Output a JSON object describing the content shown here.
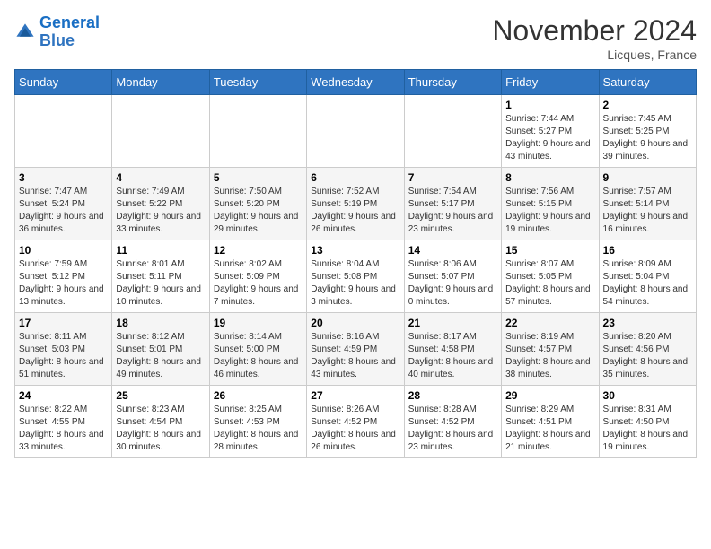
{
  "header": {
    "logo_line1": "General",
    "logo_line2": "Blue",
    "month_title": "November 2024",
    "subtitle": "Licques, France"
  },
  "weekdays": [
    "Sunday",
    "Monday",
    "Tuesday",
    "Wednesday",
    "Thursday",
    "Friday",
    "Saturday"
  ],
  "weeks": [
    [
      {
        "day": "",
        "info": ""
      },
      {
        "day": "",
        "info": ""
      },
      {
        "day": "",
        "info": ""
      },
      {
        "day": "",
        "info": ""
      },
      {
        "day": "",
        "info": ""
      },
      {
        "day": "1",
        "info": "Sunrise: 7:44 AM\nSunset: 5:27 PM\nDaylight: 9 hours and 43 minutes."
      },
      {
        "day": "2",
        "info": "Sunrise: 7:45 AM\nSunset: 5:25 PM\nDaylight: 9 hours and 39 minutes."
      }
    ],
    [
      {
        "day": "3",
        "info": "Sunrise: 7:47 AM\nSunset: 5:24 PM\nDaylight: 9 hours and 36 minutes."
      },
      {
        "day": "4",
        "info": "Sunrise: 7:49 AM\nSunset: 5:22 PM\nDaylight: 9 hours and 33 minutes."
      },
      {
        "day": "5",
        "info": "Sunrise: 7:50 AM\nSunset: 5:20 PM\nDaylight: 9 hours and 29 minutes."
      },
      {
        "day": "6",
        "info": "Sunrise: 7:52 AM\nSunset: 5:19 PM\nDaylight: 9 hours and 26 minutes."
      },
      {
        "day": "7",
        "info": "Sunrise: 7:54 AM\nSunset: 5:17 PM\nDaylight: 9 hours and 23 minutes."
      },
      {
        "day": "8",
        "info": "Sunrise: 7:56 AM\nSunset: 5:15 PM\nDaylight: 9 hours and 19 minutes."
      },
      {
        "day": "9",
        "info": "Sunrise: 7:57 AM\nSunset: 5:14 PM\nDaylight: 9 hours and 16 minutes."
      }
    ],
    [
      {
        "day": "10",
        "info": "Sunrise: 7:59 AM\nSunset: 5:12 PM\nDaylight: 9 hours and 13 minutes."
      },
      {
        "day": "11",
        "info": "Sunrise: 8:01 AM\nSunset: 5:11 PM\nDaylight: 9 hours and 10 minutes."
      },
      {
        "day": "12",
        "info": "Sunrise: 8:02 AM\nSunset: 5:09 PM\nDaylight: 9 hours and 7 minutes."
      },
      {
        "day": "13",
        "info": "Sunrise: 8:04 AM\nSunset: 5:08 PM\nDaylight: 9 hours and 3 minutes."
      },
      {
        "day": "14",
        "info": "Sunrise: 8:06 AM\nSunset: 5:07 PM\nDaylight: 9 hours and 0 minutes."
      },
      {
        "day": "15",
        "info": "Sunrise: 8:07 AM\nSunset: 5:05 PM\nDaylight: 8 hours and 57 minutes."
      },
      {
        "day": "16",
        "info": "Sunrise: 8:09 AM\nSunset: 5:04 PM\nDaylight: 8 hours and 54 minutes."
      }
    ],
    [
      {
        "day": "17",
        "info": "Sunrise: 8:11 AM\nSunset: 5:03 PM\nDaylight: 8 hours and 51 minutes."
      },
      {
        "day": "18",
        "info": "Sunrise: 8:12 AM\nSunset: 5:01 PM\nDaylight: 8 hours and 49 minutes."
      },
      {
        "day": "19",
        "info": "Sunrise: 8:14 AM\nSunset: 5:00 PM\nDaylight: 8 hours and 46 minutes."
      },
      {
        "day": "20",
        "info": "Sunrise: 8:16 AM\nSunset: 4:59 PM\nDaylight: 8 hours and 43 minutes."
      },
      {
        "day": "21",
        "info": "Sunrise: 8:17 AM\nSunset: 4:58 PM\nDaylight: 8 hours and 40 minutes."
      },
      {
        "day": "22",
        "info": "Sunrise: 8:19 AM\nSunset: 4:57 PM\nDaylight: 8 hours and 38 minutes."
      },
      {
        "day": "23",
        "info": "Sunrise: 8:20 AM\nSunset: 4:56 PM\nDaylight: 8 hours and 35 minutes."
      }
    ],
    [
      {
        "day": "24",
        "info": "Sunrise: 8:22 AM\nSunset: 4:55 PM\nDaylight: 8 hours and 33 minutes."
      },
      {
        "day": "25",
        "info": "Sunrise: 8:23 AM\nSunset: 4:54 PM\nDaylight: 8 hours and 30 minutes."
      },
      {
        "day": "26",
        "info": "Sunrise: 8:25 AM\nSunset: 4:53 PM\nDaylight: 8 hours and 28 minutes."
      },
      {
        "day": "27",
        "info": "Sunrise: 8:26 AM\nSunset: 4:52 PM\nDaylight: 8 hours and 26 minutes."
      },
      {
        "day": "28",
        "info": "Sunrise: 8:28 AM\nSunset: 4:52 PM\nDaylight: 8 hours and 23 minutes."
      },
      {
        "day": "29",
        "info": "Sunrise: 8:29 AM\nSunset: 4:51 PM\nDaylight: 8 hours and 21 minutes."
      },
      {
        "day": "30",
        "info": "Sunrise: 8:31 AM\nSunset: 4:50 PM\nDaylight: 8 hours and 19 minutes."
      }
    ]
  ]
}
